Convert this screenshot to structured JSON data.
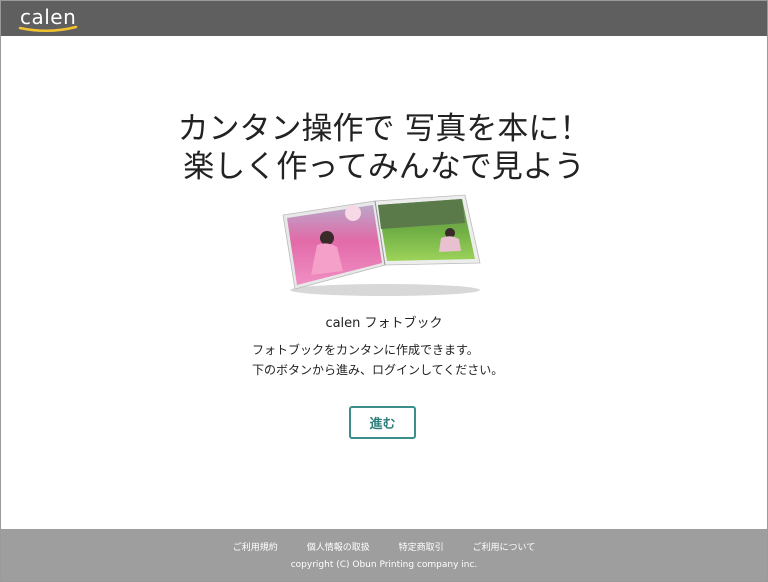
{
  "header": {
    "logo_text": "calen",
    "bg_color": "#5f5f5f"
  },
  "main": {
    "headline_line1": "カンタン操作で 写真を本に！",
    "headline_line2": "楽しく作ってみんなで見よう",
    "product_name": "calen フォトブック",
    "description_line1": "フォトブックをカンタンに作成できます。",
    "description_line2": "下のボタンから進み、ログインしてください。",
    "go_button_label": "進む",
    "accent_color": "#3b8e8a"
  },
  "footer": {
    "links": [
      "ご利用規約",
      "個人情報の取扱",
      "特定商取引",
      "ご利用について"
    ],
    "copyright": "copyright (C) Obun Printing company inc.",
    "bg_color": "#9e9e9e"
  }
}
